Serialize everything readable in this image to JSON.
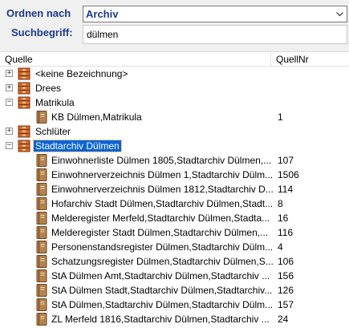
{
  "top": {
    "sort_label": "Ordnen nach",
    "sort_value": "Archiv",
    "search_label": "Suchbegriff:",
    "search_value": "dülmen"
  },
  "header": {
    "col_source": "Quelle",
    "col_number": "QuellNr"
  },
  "groups": [
    {
      "label": "<keine Bezeichnung>",
      "expander": "+"
    },
    {
      "label": "Drees",
      "expander": "+"
    },
    {
      "label": "Matrikula",
      "expander": "−"
    },
    {
      "label": "Schlüter",
      "expander": "+"
    },
    {
      "label": "Stadtarchiv Dülmen",
      "expander": "−"
    }
  ],
  "matrikula_children": [
    {
      "title": "KB Dülmen,Matrikula",
      "nr": "1"
    }
  ],
  "stadtarchiv_children": [
    {
      "title": "Einwohnerliste Dülmen 1805,Stadtarchiv Dülmen,...",
      "nr": "107"
    },
    {
      "title": "Einwohnerverzeichnis Dülmen 1,Stadtarchiv Dülm...",
      "nr": "1506"
    },
    {
      "title": "Einwohnerverzeichnis Dülmen 1812,Stadtarchiv D...",
      "nr": "114"
    },
    {
      "title": "Hofarchiv Stadt Dülmen,Stadtarchiv Dülmen,Stadt...",
      "nr": "8"
    },
    {
      "title": "Melderegister Merfeld,Stadtarchiv Dülmen,Stadta...",
      "nr": "16"
    },
    {
      "title": "Melderegister Stadt Dülmen,Stadtarchiv Dülmen,...",
      "nr": "116"
    },
    {
      "title": "Personenstandsregister Dülmen,Stadtarchiv Dülm...",
      "nr": "4"
    },
    {
      "title": "Schatzungsregister Dülmen,Stadtarchiv Dülmen,S...",
      "nr": "106"
    },
    {
      "title": "StA Dülmen Amt,Stadtarchiv Dülmen,Stadtarchiv ...",
      "nr": "156"
    },
    {
      "title": "StA Dülmen Stadt,Stadtarchiv Dülmen,Stadtarchiv...",
      "nr": "126"
    },
    {
      "title": "StA Dülmen,Stadtarchiv Dülmen,Stadtarchiv Dülm...",
      "nr": "157"
    },
    {
      "title": "ZL Merfeld 1816,Stadtarchiv Dülmen,Stadtarchiv ...",
      "nr": "24"
    }
  ]
}
